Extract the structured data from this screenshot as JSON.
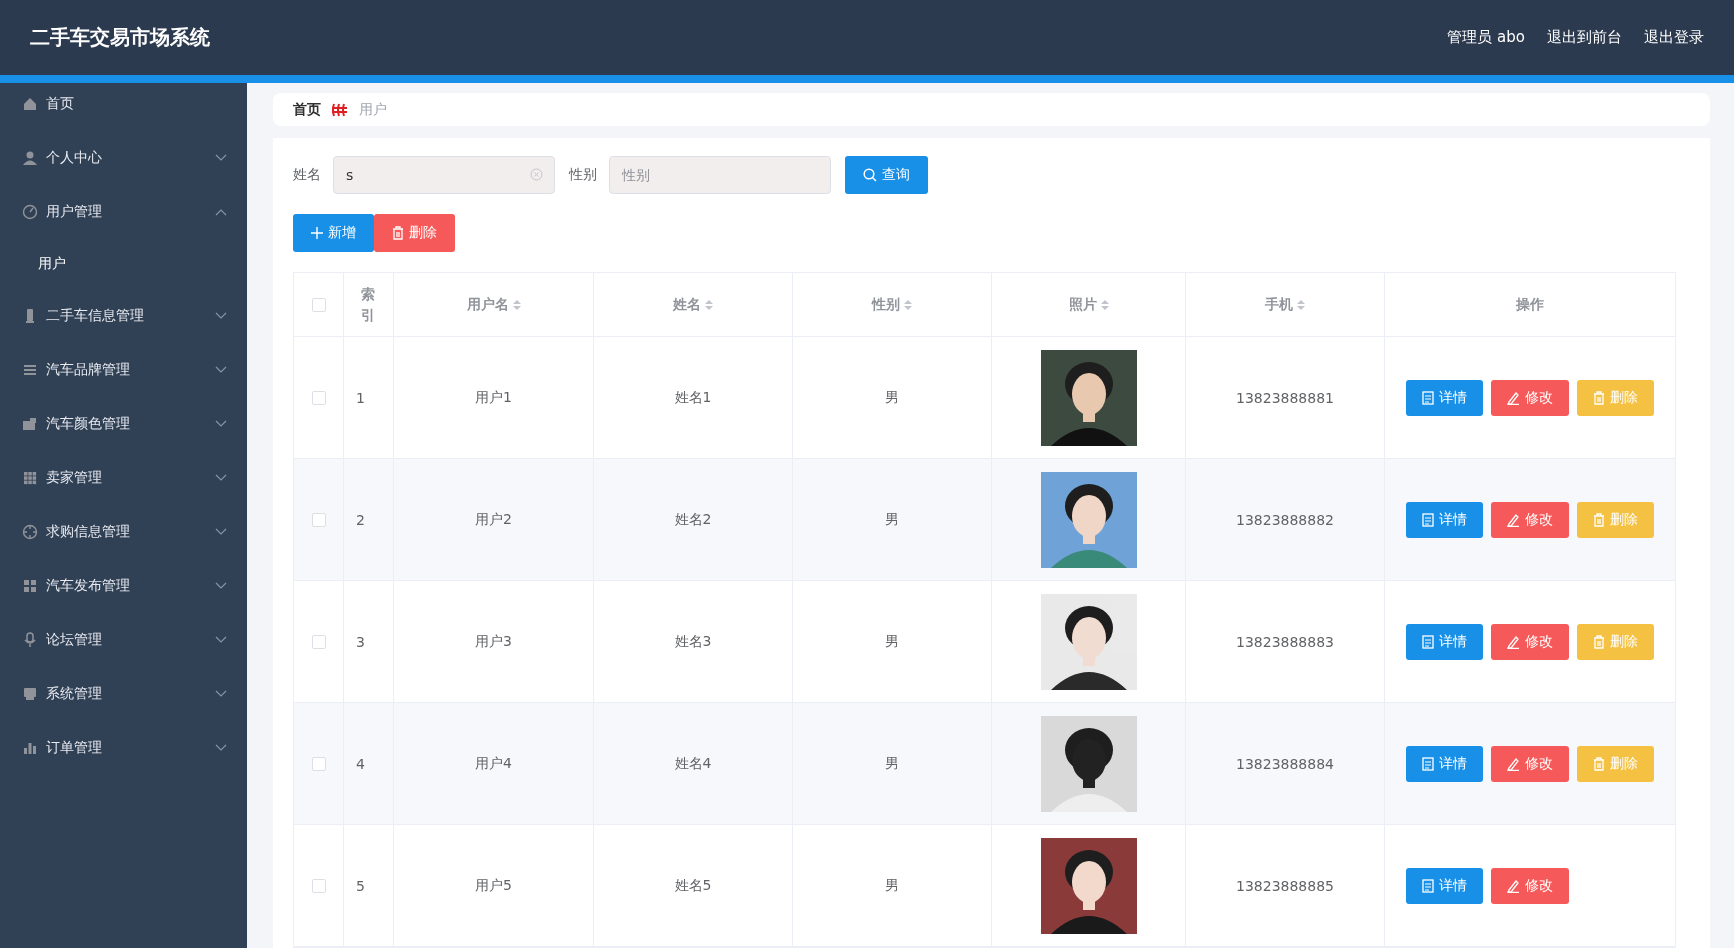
{
  "header": {
    "title": "二手车交易市场系统",
    "links": [
      "管理员 abo",
      "退出到前台",
      "退出登录"
    ]
  },
  "sidebar": {
    "items": [
      {
        "label": "首页"
      },
      {
        "label": "个人中心",
        "expanded": false
      },
      {
        "label": "用户管理",
        "expanded": true,
        "children": [
          {
            "label": "用户",
            "selected": false
          }
        ]
      },
      {
        "label": "二手车信息管理",
        "expanded": false
      },
      {
        "label": "汽车品牌管理",
        "expanded": false
      },
      {
        "label": "汽车颜色管理",
        "expanded": false
      },
      {
        "label": "卖家管理",
        "expanded": false
      },
      {
        "label": "求购信息管理",
        "expanded": false
      },
      {
        "label": "汽车发布管理",
        "expanded": false
      },
      {
        "label": "论坛管理",
        "expanded": false
      },
      {
        "label": "系统管理",
        "expanded": false
      },
      {
        "label": "订单管理",
        "expanded": false
      }
    ]
  },
  "breadcrumb": [
    "首页",
    "用户"
  ],
  "search": {
    "fields": [
      {
        "label": "姓名",
        "value": "s"
      },
      {
        "label": "性别",
        "placeholder": "性别"
      }
    ],
    "button": "查询"
  },
  "actions": [
    {
      "kind": "add",
      "label": "新增"
    },
    {
      "kind": "delete",
      "label": "删除"
    }
  ],
  "table": {
    "header_checked": false,
    "columns": [
      {
        "label": "索引",
        "sortable": false
      },
      {
        "label": "用户名",
        "sortable": true
      },
      {
        "label": "姓名",
        "sortable": true
      },
      {
        "label": "性别",
        "sortable": true
      },
      {
        "label": "照片",
        "sortable": true
      },
      {
        "label": "手机",
        "sortable": true
      },
      {
        "label": "操作",
        "sortable": false
      }
    ],
    "rows": [
      {
        "checked": false,
        "index": "1",
        "username": "用户1",
        "name": "姓名1",
        "gender": "男",
        "photo": {
          "kind": "picture"
        },
        "phone": "13823888881",
        "buttons": [
          {
            "kind": "detail",
            "label": "详情"
          },
          {
            "kind": "edit",
            "label": "修改"
          },
          {
            "kind": "delete",
            "label": "删除"
          }
        ]
      },
      {
        "checked": false,
        "index": "2",
        "username": "用户2",
        "name": "姓名2",
        "gender": "男",
        "photo": {
          "kind": "picture"
        },
        "phone": "13823888882",
        "buttons": [
          {
            "kind": "detail",
            "label": "详情"
          },
          {
            "kind": "edit",
            "label": "修改"
          },
          {
            "kind": "delete",
            "label": "删除"
          }
        ]
      },
      {
        "checked": false,
        "index": "3",
        "username": "用户3",
        "name": "姓名3",
        "gender": "男",
        "photo": {
          "kind": "picture"
        },
        "phone": "13823888883",
        "buttons": [
          {
            "kind": "detail",
            "label": "详情"
          },
          {
            "kind": "edit",
            "label": "修改"
          },
          {
            "kind": "delete",
            "label": "删除"
          }
        ]
      },
      {
        "checked": false,
        "index": "4",
        "username": "用户4",
        "name": "姓名4",
        "gender": "男",
        "photo": {
          "kind": "picture"
        },
        "phone": "13823888884",
        "buttons": [
          {
            "kind": "detail",
            "label": "详情"
          },
          {
            "kind": "edit",
            "label": "修改"
          },
          {
            "kind": "delete",
            "label": "删除"
          }
        ]
      },
      {
        "checked": false,
        "index": "5",
        "username": "用户5",
        "name": "姓名5",
        "gender": "男",
        "photo": {
          "kind": "picture"
        },
        "phone": "13823888885",
        "buttons": [
          {
            "kind": "detail",
            "label": "详情"
          },
          {
            "kind": "edit",
            "label": "修改"
          }
        ]
      }
    ]
  }
}
